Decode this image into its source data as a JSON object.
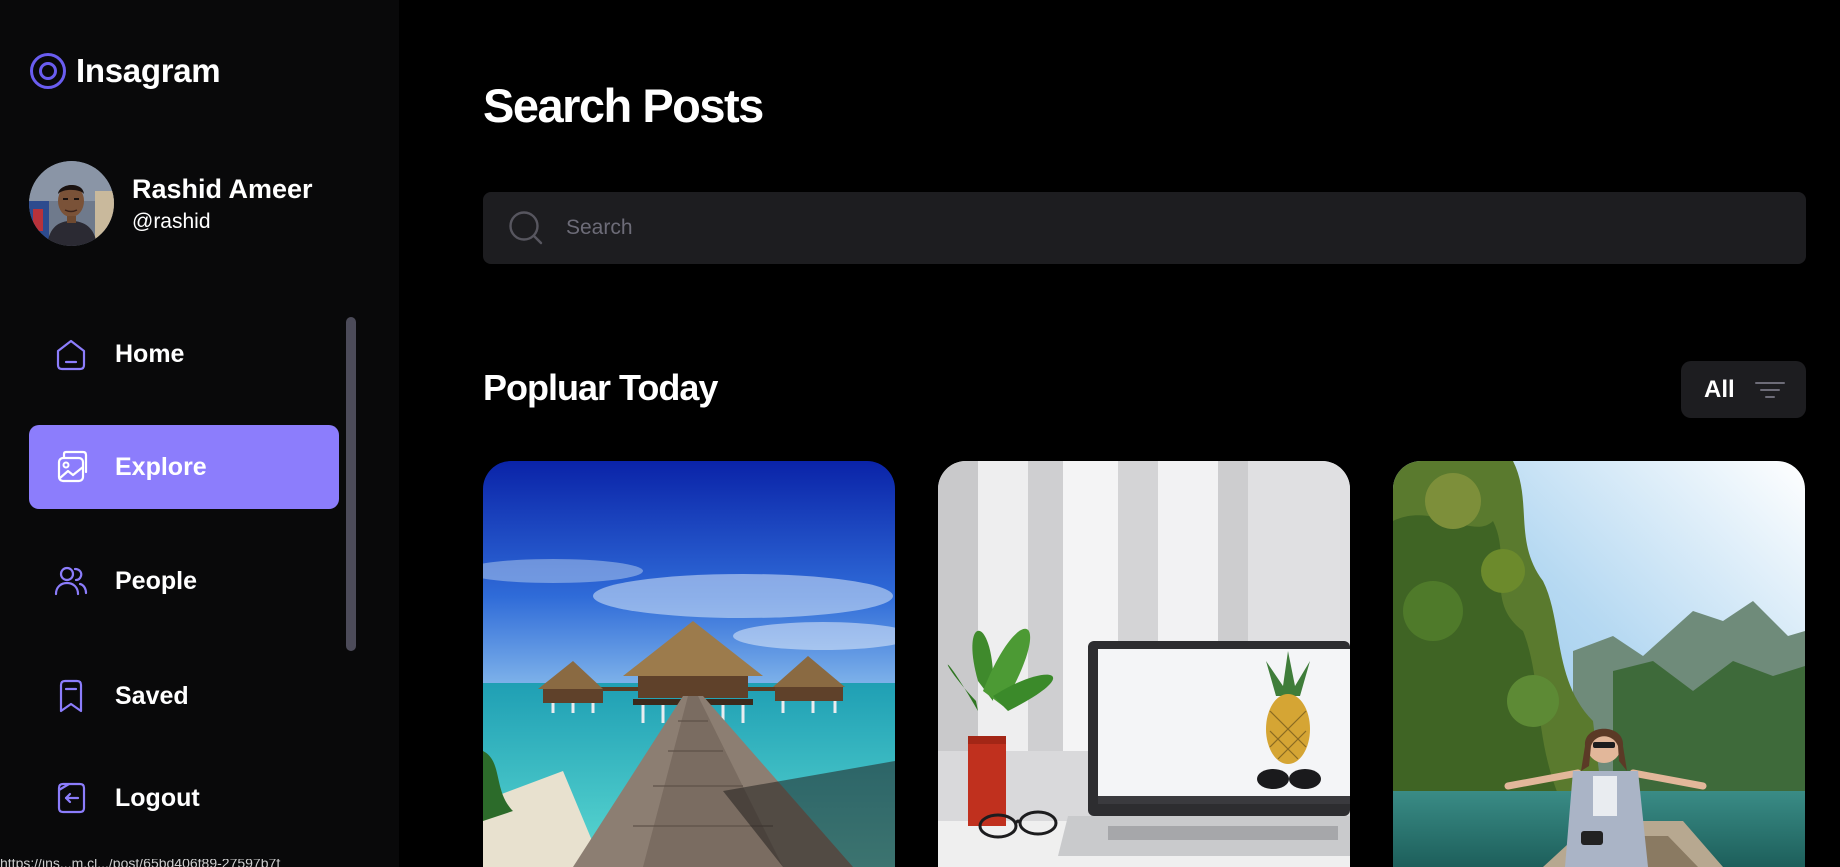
{
  "app": {
    "name": "Insagram",
    "logo_icon": "camera-ring-icon",
    "accent_color": "#8c7dfc"
  },
  "profile": {
    "name": "Rashid Ameer",
    "handle": "@rashid"
  },
  "nav": {
    "items": [
      {
        "label": "Home",
        "icon": "home-icon",
        "active": false
      },
      {
        "label": "Explore",
        "icon": "gallery-icon",
        "active": true
      },
      {
        "label": "People",
        "icon": "people-icon",
        "active": false
      },
      {
        "label": "Saved",
        "icon": "bookmark-icon",
        "active": false
      },
      {
        "label": "Logout",
        "icon": "logout-icon",
        "active": false
      }
    ]
  },
  "main": {
    "title": "Search Posts",
    "search": {
      "placeholder": "Search",
      "value": ""
    },
    "section_title": "Popluar Today",
    "filter": {
      "label": "All",
      "icon": "filter-lines-icon"
    },
    "posts": [
      {
        "subject": "overwater-bungalow-pier"
      },
      {
        "subject": "laptop-desk-pineapple"
      },
      {
        "subject": "woman-on-boat-lake"
      }
    ]
  },
  "status_bar": {
    "url": "https://ins...m.cl.../post/65bd406f89-27597b7f"
  }
}
